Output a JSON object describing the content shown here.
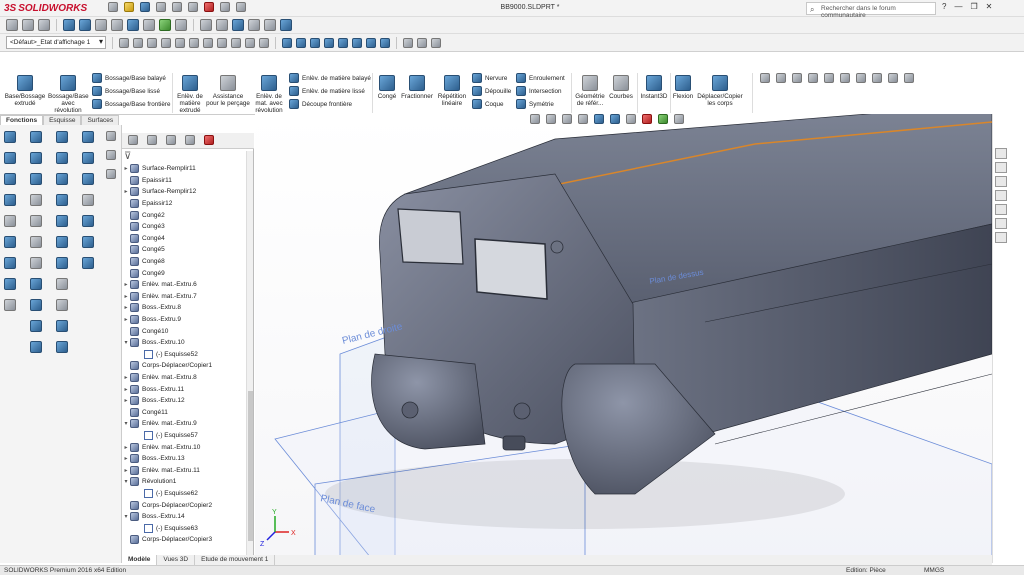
{
  "titlebar": {
    "brand_prefix": "3S",
    "brand": "SOLIDWORKS",
    "document_title": "BB9000.SLDPRT *",
    "search_placeholder": "Rechercher dans le forum communautaire",
    "help_label": "?"
  },
  "toolbar2": {
    "configuration": "<Défaut>_Etat d'affichage 1"
  },
  "command_manager": {
    "buttons": [
      {
        "label": "Base/Bossage extrudé"
      },
      {
        "label": "Bossage/Base avec révolution"
      },
      {
        "label": "Bossage/Base balayé"
      },
      {
        "label": "Bossage/Base lissé"
      },
      {
        "label": "Bossage/Base frontière"
      },
      {
        "label": "Enlèv. de matière extrudé"
      },
      {
        "label": "Assistance pour le perçage"
      },
      {
        "label": "Enlèv. de mat. avec révolution"
      },
      {
        "label": "Enlèv. de matière balayé"
      },
      {
        "label": "Enlèv. de matière lissé"
      },
      {
        "label": "Découpe frontière"
      },
      {
        "label": "Congé"
      },
      {
        "label": "Fractionner"
      },
      {
        "label": "Répétition linéaire"
      },
      {
        "label": "Nervure"
      },
      {
        "label": "Dépouille"
      },
      {
        "label": "Coque"
      },
      {
        "label": "Enroulement"
      },
      {
        "label": "Intersection"
      },
      {
        "label": "Symétrie"
      },
      {
        "label": "Géométrie de référ..."
      },
      {
        "label": "Courbes"
      },
      {
        "label": "Instant3D"
      },
      {
        "label": "Flexion"
      },
      {
        "label": "Déplacer/Copier les corps"
      }
    ]
  },
  "tabs": {
    "fonctions": "Fonctions",
    "esquisse": "Esquisse",
    "surfaces": "Surfaces"
  },
  "feature_tree": {
    "items": [
      {
        "label": "Surface-Remplir11",
        "expand": "▸",
        "type": "feature"
      },
      {
        "label": "Epaissir11",
        "expand": "",
        "type": "feature"
      },
      {
        "label": "Surface-Remplir12",
        "expand": "▸",
        "type": "feature"
      },
      {
        "label": "Epaissir12",
        "expand": "",
        "type": "feature"
      },
      {
        "label": "Congé2",
        "expand": "",
        "type": "feature"
      },
      {
        "label": "Congé3",
        "expand": "",
        "type": "feature"
      },
      {
        "label": "Congé4",
        "expand": "",
        "type": "feature"
      },
      {
        "label": "Congé5",
        "expand": "",
        "type": "feature"
      },
      {
        "label": "Congé8",
        "expand": "",
        "type": "feature"
      },
      {
        "label": "Congé9",
        "expand": "",
        "type": "feature"
      },
      {
        "label": "Enlèv. mat.-Extru.6",
        "expand": "▸",
        "type": "feature"
      },
      {
        "label": "Enlèv. mat.-Extru.7",
        "expand": "▸",
        "type": "feature"
      },
      {
        "label": "Boss.-Extru.8",
        "expand": "▸",
        "type": "feature"
      },
      {
        "label": "Boss.-Extru.9",
        "expand": "▸",
        "type": "feature"
      },
      {
        "label": "Congé10",
        "expand": "",
        "type": "feature"
      },
      {
        "label": "Boss.-Extru.10",
        "expand": "▾",
        "type": "feature"
      },
      {
        "label": "(-) Esquisse52",
        "expand": "",
        "type": "sketch",
        "indent": 1
      },
      {
        "label": "Corps-Déplacer/Copier1",
        "expand": "",
        "type": "feature"
      },
      {
        "label": "Enlèv. mat.-Extru.8",
        "expand": "▸",
        "type": "feature"
      },
      {
        "label": "Boss.-Extru.11",
        "expand": "▸",
        "type": "feature"
      },
      {
        "label": "Boss.-Extru.12",
        "expand": "▸",
        "type": "feature"
      },
      {
        "label": "Congé11",
        "expand": "",
        "type": "feature"
      },
      {
        "label": "Enlèv. mat.-Extru.9",
        "expand": "▾",
        "type": "feature"
      },
      {
        "label": "(-) Esquisse57",
        "expand": "",
        "type": "sketch",
        "indent": 1
      },
      {
        "label": "Enlèv. mat.-Extru.10",
        "expand": "▸",
        "type": "feature"
      },
      {
        "label": "Boss.-Extru.13",
        "expand": "▸",
        "type": "feature"
      },
      {
        "label": "Enlèv. mat.-Extru.11",
        "expand": "▸",
        "type": "feature"
      },
      {
        "label": "Révolution1",
        "expand": "▾",
        "type": "feature"
      },
      {
        "label": "(-) Esquisse62",
        "expand": "",
        "type": "sketch",
        "indent": 1
      },
      {
        "label": "Corps-Déplacer/Copier2",
        "expand": "",
        "type": "feature"
      },
      {
        "label": "Boss.-Extru.14",
        "expand": "▾",
        "type": "feature"
      },
      {
        "label": "(-) Esquisse63",
        "expand": "",
        "type": "sketch",
        "indent": 1
      },
      {
        "label": "Corps-Déplacer/Copier3",
        "expand": "",
        "type": "feature"
      }
    ]
  },
  "viewport": {
    "plane_right": "Plan de droite",
    "plane_front": "Plan de face",
    "plane_top": "Plan de dessus",
    "triad_x": "X",
    "triad_y": "Y",
    "triad_z": "Z"
  },
  "bottom_tabs": {
    "model": "Modèle",
    "views3d": "Vues 3D",
    "motion": "Etude de mouvement 1"
  },
  "status": {
    "product": "SOLIDWORKS Premium 2016 x64 Edition",
    "edition": "Edition: Pièce",
    "units": "MMGS"
  },
  "colors": {
    "accent": "#c8102e",
    "model": "#5a6170",
    "plane": "#6b8cd8",
    "edge_highlight": "#d9862a"
  }
}
